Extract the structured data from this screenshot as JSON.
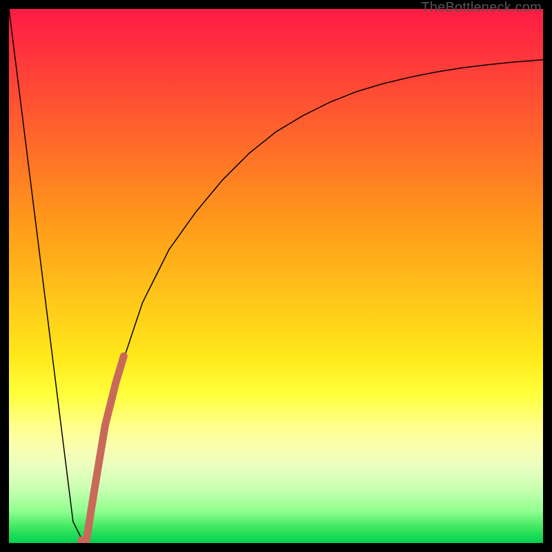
{
  "watermark": "TheBottleneck.com",
  "chart_data": {
    "type": "line",
    "title": "",
    "xlabel": "",
    "ylabel": "",
    "xlim": [
      0,
      100
    ],
    "ylim": [
      0,
      100
    ],
    "grid": false,
    "legend": false,
    "series": [
      {
        "name": "bottleneck-curve",
        "x": [
          0,
          5,
          10,
          12,
          14,
          16,
          18,
          20,
          25,
          30,
          35,
          40,
          45,
          50,
          55,
          60,
          65,
          70,
          75,
          80,
          85,
          90,
          95,
          100
        ],
        "values": [
          100,
          60,
          20,
          4,
          0,
          10,
          22,
          30,
          45,
          55,
          62,
          68,
          73,
          77,
          80,
          82.5,
          84.5,
          86,
          87.2,
          88.2,
          89,
          89.6,
          90.1,
          90.5
        ],
        "color": "#000000",
        "width": 1.5
      },
      {
        "name": "highlight-segment",
        "x": [
          13.5,
          14.5,
          16,
          18,
          20,
          21.5
        ],
        "values": [
          0.5,
          0.5,
          10,
          22,
          30,
          35
        ],
        "color": "#c86a5a",
        "width": 11
      }
    ],
    "background_gradient_stops": [
      {
        "pos": 0,
        "color": "#ff1a45"
      },
      {
        "pos": 50,
        "color": "#ffc81a"
      },
      {
        "pos": 78,
        "color": "#ffff8a"
      },
      {
        "pos": 100,
        "color": "#00d050"
      }
    ]
  }
}
